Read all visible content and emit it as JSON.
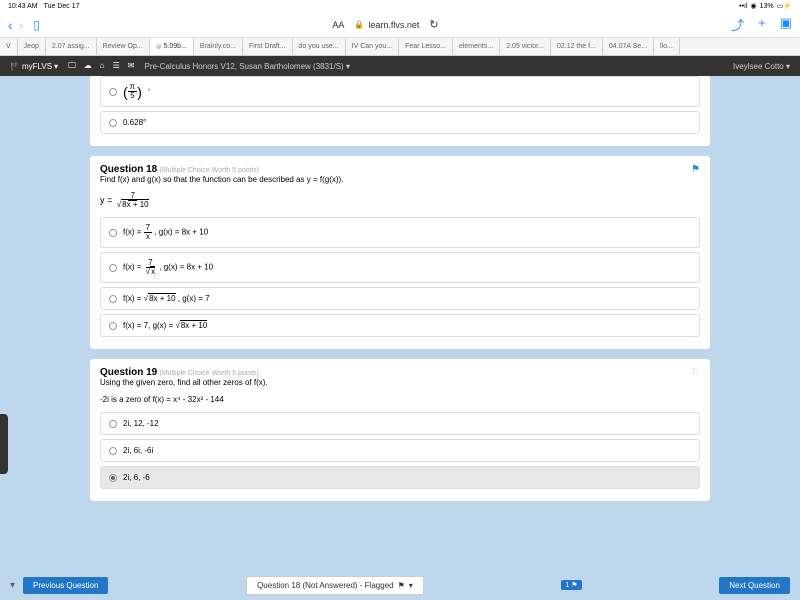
{
  "status": {
    "time": "10:43 AM",
    "date": "Tue Dec 17",
    "battery": "13%"
  },
  "browser": {
    "aa": "AA",
    "url": "learn.flvs.net",
    "tabs": [
      {
        "label": "V"
      },
      {
        "label": "Jeop"
      },
      {
        "label": "2.07 assig..."
      },
      {
        "label": "Review Op..."
      },
      {
        "label": "5.09b...",
        "active": true
      },
      {
        "label": "Brainly.co..."
      },
      {
        "label": "First Draft..."
      },
      {
        "label": "do you use..."
      },
      {
        "label": "IV Can you..."
      },
      {
        "label": "Fear Lesso..."
      },
      {
        "label": "elements..."
      },
      {
        "label": "2.05 victor..."
      },
      {
        "label": "02.12 the f..."
      },
      {
        "label": "04.07A Se..."
      },
      {
        "label": "llo..."
      }
    ]
  },
  "flvs": {
    "logo": "myFLVS",
    "course": "Pre-Calculus Honors V12, Susan Bartholomew (3831/S)",
    "user": "Iveylsee Cotto"
  },
  "q17_topanswers": {
    "opt1": "π",
    "opt1b": "5",
    "opt2": "0.628°"
  },
  "q18": {
    "title": "Question 18",
    "meta": "(Multiple Choice Worth 5 points)",
    "text": "Find f(x) and g(x) so that the function can be described as y = f(g(x)).",
    "eq_num": "7",
    "eq_den": "8x + 10",
    "opt1_a": "f(x) = ",
    "opt1_num": "7",
    "opt1_den": "x",
    "opt1_b": " , g(x) = 8x + 10",
    "opt2_a": "f(x) = ",
    "opt2_num": "7",
    "opt2_den": "x",
    "opt2_b": " , g(x) = 8x + 10",
    "opt3": "f(x) = ",
    "opt3_sqrt": "8x + 10",
    "opt3_b": " , g(x) = 7",
    "opt4": "f(x) = 7, g(x) = ",
    "opt4_sqrt": "8x + 10"
  },
  "q19": {
    "title": "Question 19",
    "meta": "(Multiple Choice Worth 5 points)",
    "text": "Using the given zero, find all other zeros of f(x).",
    "given": "-2i is a zero of f(x) = x⁴ - 32x² - 144",
    "opt1": "2i, 12, -12",
    "opt2": "2i, 6i, -6i",
    "opt3": "2i, 6, -6"
  },
  "bottom": {
    "prev": "Previous Question",
    "status": "Question 18 (Not Answered) - Flagged",
    "count": "1",
    "next": "Next Question"
  }
}
